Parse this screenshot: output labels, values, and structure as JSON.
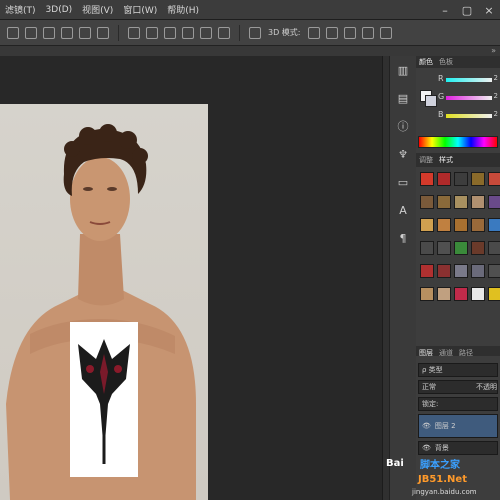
{
  "menu": {
    "items": [
      "滤镜(T)",
      "3D(D)",
      "视图(V)",
      "窗口(W)",
      "帮助(H)"
    ],
    "window_controls": [
      "–",
      "▢",
      "×"
    ]
  },
  "options_bar": {
    "mode_label": "3D 模式:"
  },
  "color_panel": {
    "tabs": [
      "颜色",
      "色板"
    ],
    "channels": [
      {
        "label": "R",
        "value": "2",
        "color": "#e0e0e0"
      },
      {
        "label": "G",
        "value": "2",
        "color": "#e0e0e0"
      },
      {
        "label": "B",
        "value": "2",
        "color": "#e0e0e0"
      }
    ]
  },
  "styles_panel": {
    "tabs": [
      "调整",
      "样式"
    ],
    "swatches": [
      "#d43a2b",
      "#b02a2a",
      "#3d3d3d",
      "#8a6a2a",
      "#c84a3a",
      "#7a5a3a",
      "#8a6a3a",
      "#a89060",
      "#b09070",
      "#6a4a8a",
      "#d0a050",
      "#c08040",
      "#a87030",
      "#9a6a3a",
      "#3a7ac0",
      "#4a4a4a",
      "#505050",
      "#3a8a3a",
      "#6a3a2a",
      "#4a4a4a",
      "#b03030",
      "#8a3030",
      "#7a7a8a",
      "#6a6a7a",
      "#505050",
      "#b89060",
      "#c0a080",
      "#c02a4a",
      "#e8e8e8",
      "#e0c020"
    ]
  },
  "layers_panel": {
    "tabs": [
      "图层",
      "通道",
      "路径"
    ],
    "filter_label": "ρ 类型",
    "blend_mode": "正常",
    "opacity_label": "不透明",
    "lock_label": "锁定:",
    "layers": [
      "图层 2",
      "背景"
    ]
  },
  "watermarks": {
    "baidu": "Bai",
    "jb51": "脚本之家",
    "jb51_url": "JB51.Net",
    "jingyan": "jingyan.baidu.com"
  }
}
